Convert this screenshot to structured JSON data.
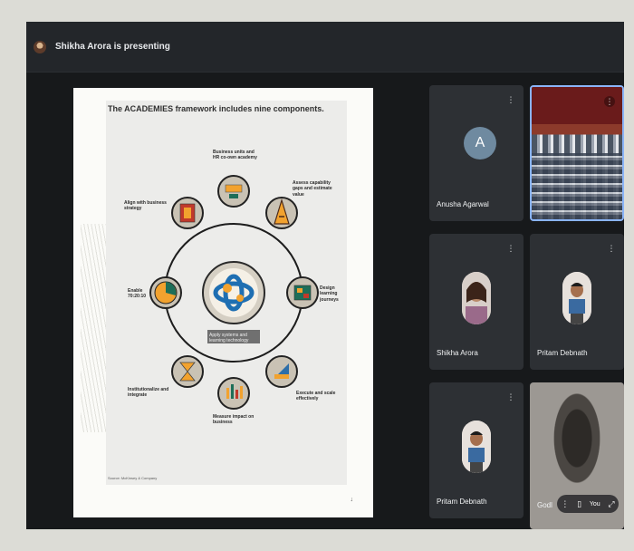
{
  "presenter_banner": {
    "text": "Shikha Arora is presenting"
  },
  "slide": {
    "title": "The ACADEMIES framework includes nine components.",
    "center_label": "Apply systems and learning technology",
    "source": "Source: McKinsey & Company",
    "page_mark": "↓",
    "nodes": [
      {
        "label": "Business units and HR co-own academy"
      },
      {
        "label": "Assess capability gaps and estimate value"
      },
      {
        "label": "Design learning journeys"
      },
      {
        "label": "Execute and scale effectively"
      },
      {
        "label": "Measure impact on business"
      },
      {
        "label": "Institutionalize and integrate"
      },
      {
        "label": "Enable 70:20:10"
      },
      {
        "label": "Align with business strategy"
      }
    ]
  },
  "participants": [
    {
      "name": "Anusha Agarwal",
      "avatar_letter": "A",
      "menu_icon": "more-vert-icon"
    },
    {
      "name": "",
      "menu_icon": "more-vert-icon"
    },
    {
      "name": "Shikha Arora",
      "menu_icon": "more-vert-icon"
    },
    {
      "name": "Pritam Debnath",
      "menu_icon": "more-vert-icon"
    },
    {
      "name": "Pritam Debnath",
      "menu_icon": "more-vert-icon"
    },
    {
      "name": "Godl",
      "you_label": "You"
    }
  ],
  "colors": {
    "stage_bg": "#17191b",
    "tile_bg": "#2d3034",
    "active_tile_border": "#8ab4f8",
    "avatar_blue": "#6f8aa0"
  }
}
